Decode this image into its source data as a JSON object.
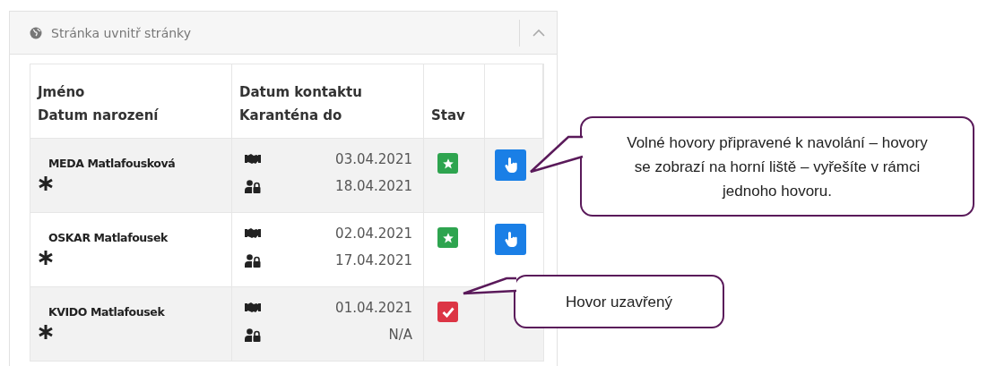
{
  "panel": {
    "title": "Stránka uvnitř stránky",
    "expanded": true
  },
  "table": {
    "columns": [
      {
        "lines": [
          "Jméno",
          "Datum narození"
        ]
      },
      {
        "lines": [
          "Datum kontaktu",
          "Karanténa do"
        ]
      },
      {
        "lines": [
          "Stav"
        ]
      }
    ],
    "rows": [
      {
        "name": "MEDA Matlafousková",
        "contact_date": "03.04.2021",
        "quarantine_until": "18.04.2021",
        "closed": false,
        "callable": true
      },
      {
        "name": "OSKAR Matlafousek",
        "contact_date": "02.04.2021",
        "quarantine_until": "17.04.2021",
        "closed": false,
        "callable": true
      },
      {
        "name": "KVIDO Matlafousek",
        "contact_date": "01.04.2021",
        "quarantine_until": "N/A",
        "closed": true,
        "callable": false
      }
    ]
  },
  "callouts": [
    {
      "text": "Volné hovory připravené k navolání – hovory se zobrazí na horní liště – vyřešíte v rámci jednoho hovoru.",
      "kind": "call"
    },
    {
      "text": "Hovor uzavřený",
      "kind": "closed"
    }
  ]
}
